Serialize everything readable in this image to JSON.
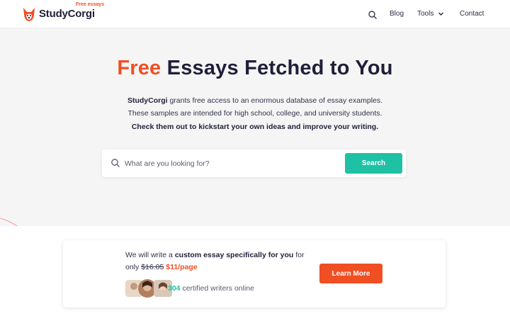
{
  "brand": {
    "tagline": "Free essays",
    "name": "StudyCorgi",
    "accent_color": "#f04e23",
    "cta_color": "#1fc1a5"
  },
  "nav": {
    "items": [
      {
        "label": "Blog"
      },
      {
        "label": "Tools"
      },
      {
        "label": "Contact"
      }
    ],
    "search_icon": "search-icon"
  },
  "hero": {
    "title_accent": "Free",
    "title_rest": " Essays Fetched to You",
    "brand_bold": "StudyCorgi",
    "line1_rest": " grants free access to an enormous database of essay examples.",
    "line2": "These samples are intended for high school, college, and university students.",
    "line3": "Check them out to kickstart your own ideas and improve your writing."
  },
  "search": {
    "placeholder": "What are you looking for?",
    "button_label": "Search"
  },
  "promo": {
    "text_before": "We will write a ",
    "text_bold": "custom essay specifically for you",
    "text_after": " for",
    "only": "only ",
    "old_price": "$16.05",
    "new_price": "$11/page",
    "writers_count": "304",
    "writers_text": " certified writers online",
    "button_label": "Learn More"
  }
}
